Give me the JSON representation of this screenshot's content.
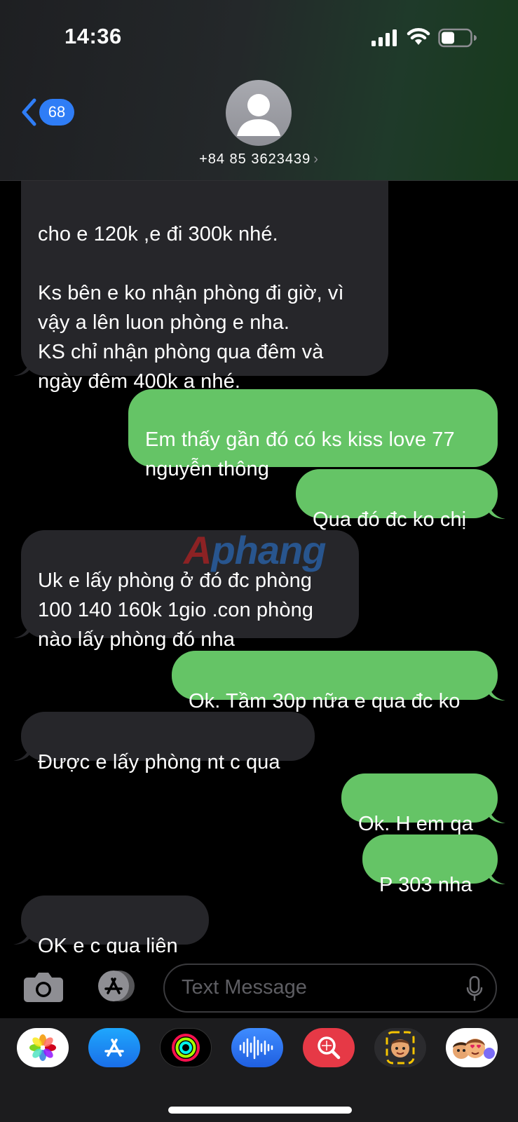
{
  "status_bar": {
    "time": "14:36"
  },
  "header": {
    "back_count": "68",
    "contact": "+84 85 3623439",
    "contact_chevron": "›"
  },
  "messages": [
    {
      "from": "them",
      "text": "cho e 120k ,e đi 300k nhé.\n\nKs bên e ko nhận phòng đi giờ, vì\nvậy a  lên luon phòng e nha.\nKS chỉ nhận phòng qua đêm và\nngày  đêm 400k a nhé."
    },
    {
      "from": "me",
      "text": "Em thấy gần đó có ks kiss love 77\nnguyễn thông"
    },
    {
      "from": "me",
      "text": "Qua đó đc ko chị"
    },
    {
      "from": "them",
      "text": "Uk e lấy phòng ở đó đc phòng\n100 140 160k 1gio .con phòng\nnào lấy phòng đó nha"
    },
    {
      "from": "me",
      "text": "Ok. Tầm 30p nữa e qua đc ko"
    },
    {
      "from": "them",
      "text": "Được e lấy phòng nt c qua"
    },
    {
      "from": "me",
      "text": "Ok. H em qa"
    },
    {
      "from": "me",
      "text": "P 303 nha"
    },
    {
      "from": "them",
      "text": "OK e c qua liên"
    }
  ],
  "watermark": {
    "first_letter": "A",
    "rest": "phang"
  },
  "input_bar": {
    "placeholder": "Text Message"
  },
  "app_drawer": {
    "apps": [
      "photos-icon",
      "app-store-icon",
      "fitness-icon",
      "voice-memo-icon",
      "images-search-icon",
      "memoji-icon",
      "memoji-stickers-icon"
    ]
  },
  "colors": {
    "sent_bubble": "#65c466",
    "received_bubble": "#26262a",
    "badge": "#2f7df6"
  }
}
